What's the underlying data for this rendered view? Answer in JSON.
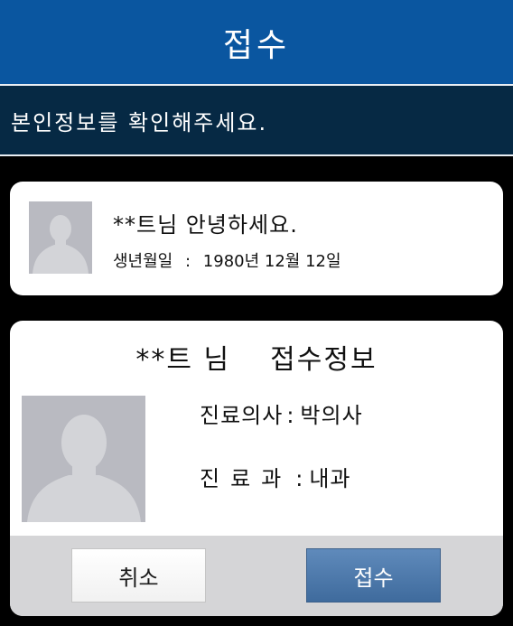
{
  "header": {
    "title": "접수"
  },
  "notice": {
    "text": "본인정보를 확인해주세요."
  },
  "greeting_card": {
    "avatar": "user-silhouette-icon",
    "greeting": "**트님 안녕하세요.",
    "birth_label": "생년월일",
    "birth_colon": ":",
    "birth_value": "1980년 12월 12일"
  },
  "reception_card": {
    "name": "**트 님",
    "title": "접수정보",
    "avatar": "user-silhouette-icon",
    "doctor_label": "진료의사",
    "doctor_value": "박의사",
    "dept_label": "진료과",
    "dept_value": "내과",
    "colon": ":",
    "cancel_label": "취소",
    "submit_label": "접수"
  },
  "colors": {
    "header_bg": "#0a56a0",
    "notice_bg": "#062944",
    "page_bg": "#000000",
    "submit_button": "#4f7aad"
  }
}
